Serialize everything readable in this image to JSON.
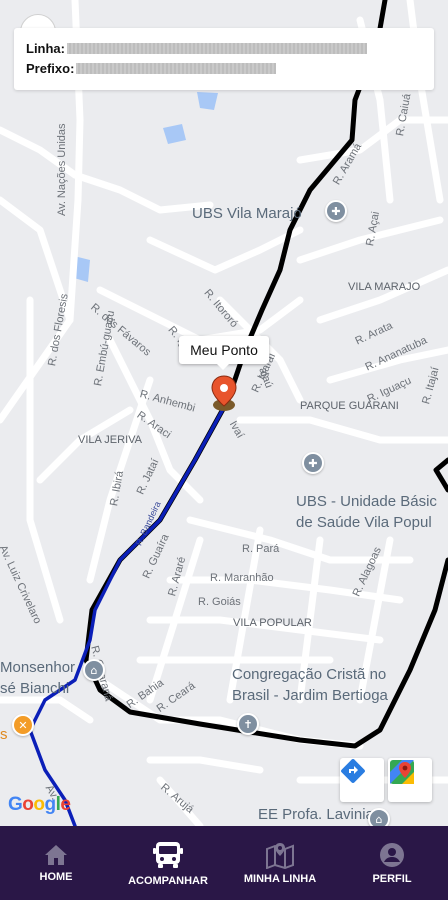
{
  "info": {
    "line_label": "Linha:",
    "prefix_label": "Prefixo:"
  },
  "stop": {
    "label": "Meu Ponto"
  },
  "map": {
    "attribution": "Google",
    "route_colors": {
      "full_route": "#000000",
      "travelled": "#0b1fb8"
    },
    "neighborhoods": [
      "VILA MARAJO",
      "PARQUE GUARANI",
      "VILA JERIVA",
      "VILA POPULAR"
    ],
    "pois": {
      "ubs_marajo": "UBS Vila Marajó",
      "ubs_popular_1": "UBS - Unidade Básic",
      "ubs_popular_2": "de Saúde Vila Popul",
      "church_1": "Congregação Cristã no",
      "church_2": "Brasil - Jardim Bertioga",
      "monsenhor_1": "Monsenhor",
      "monsenhor_2": "sé Bianchi",
      "school": "EE Profa. Lavinia",
      "food_prefix": "s"
    },
    "streets": {
      "nacoes": "Av. Nações Unidas",
      "favaros": "R. dos Fávaros",
      "floresis": "R. dos Floresis",
      "embu": "R. Embú-guaçu",
      "anhembi": "R. Anhembi",
      "araci": "R. Araci",
      "itororo": "R. Itororó",
      "ig": "R. Ig",
      "igarai": "R. Igaraí",
      "acai_top": "R. Açai",
      "acai": "R. Açai",
      "caiua": "R. Caiuá",
      "arama": "R. Aramá",
      "arata": "R. Arata",
      "ananatuba": "R. Ananatuba",
      "iguacu": "R. Iguaçu",
      "itajai": "R. Itajaí",
      "jatai": "R. Jataí",
      "ibira": "R. Ibirá",
      "bandeirantes": "R. Bandeira",
      "guaira": "R. Guaíra",
      "arare": "R. Araré",
      "para": "R. Pará",
      "maranhao": "R. Maranhão",
      "goias": "R. Goiás",
      "alagoas": "R. Alagoas",
      "guarana": "R. Guaraná",
      "bahia": "R. Bahia",
      "ceara": "R. Ceará",
      "aruja": "R. Arujá",
      "luiz": "Av. Luiz Crivelaro",
      "av_bottom": "Av.",
      "ivai": "Ivaí",
      "unidade": "ajaú"
    }
  },
  "nav": {
    "items": [
      {
        "label": "HOME",
        "icon": "home-icon"
      },
      {
        "label": "ACOMPANHAR",
        "icon": "bus-icon"
      },
      {
        "label": "MINHA LINHA",
        "icon": "map-icon"
      },
      {
        "label": "PERFIL",
        "icon": "profile-icon"
      }
    ]
  }
}
